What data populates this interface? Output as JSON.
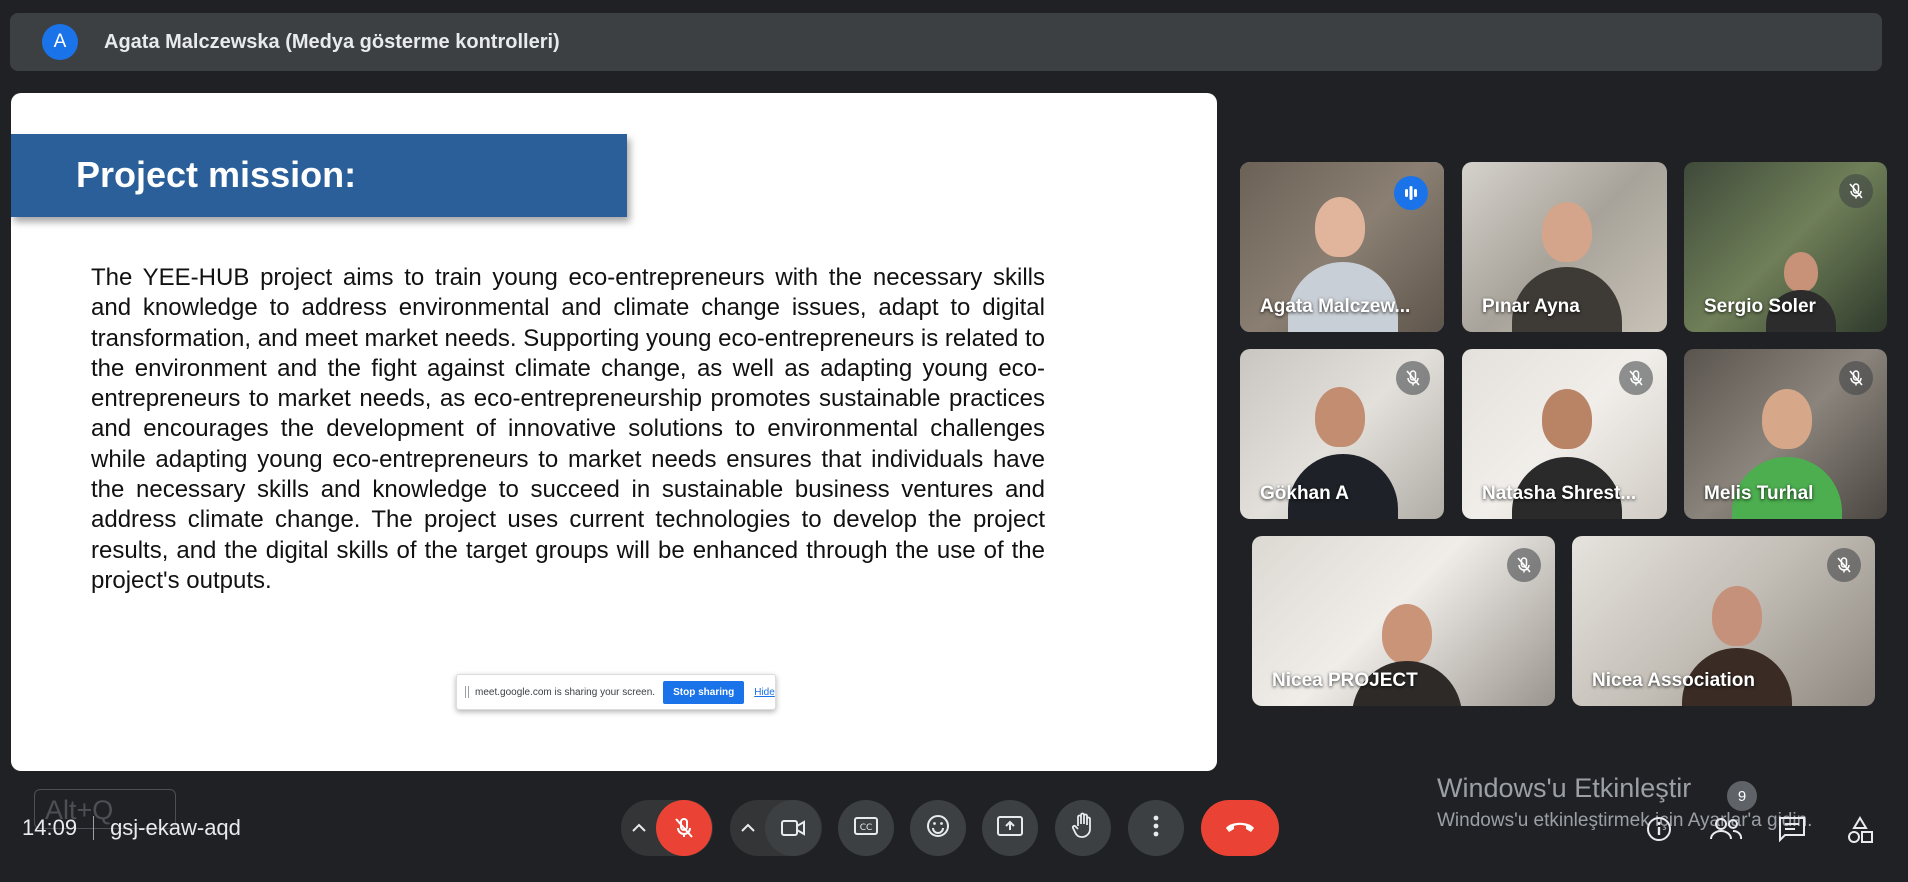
{
  "header": {
    "avatar_letter": "A",
    "title": "Agata Malczewska (Medya gösterme kontrolleri)"
  },
  "slide": {
    "heading": "Project mission:",
    "body": "The YEE-HUB project aims to train young eco-entrepreneurs with the necessary skills and knowledge to address environmental and climate change issues, adapt to digital transformation, and meet market needs. Supporting young eco-entrepreneurs is related to the environment and the fight against climate change, as well as adapting young eco-entrepreneurs to market needs, as eco-entrepreneurship promotes sustainable practices and encourages the development of innovative solutions to environmental challenges while adapting young eco-entrepreneurs to market needs ensures that individuals have the necessary skills and knowledge to succeed in sustainable business ventures and address climate change. The project uses current technologies to develop the project results, and the digital skills of the target groups will be enhanced through the use of the project's outputs.",
    "share_bar": {
      "message": "meet.google.com is sharing your screen.",
      "stop_label": "Stop sharing",
      "hide_label": "Hide"
    }
  },
  "participants": [
    {
      "name": "Agata Malczew...",
      "speaking": true
    },
    {
      "name": "Pınar Ayna",
      "muted": false
    },
    {
      "name": "Sergio Soler",
      "muted": true
    },
    {
      "name": "Gökhan A",
      "muted": true
    },
    {
      "name": "Natasha Shrest...",
      "muted": true
    },
    {
      "name": "Melis Turhal",
      "muted": true
    },
    {
      "name": "Nicea PROJECT",
      "muted": true
    },
    {
      "name": "Nicea Association",
      "muted": true
    }
  ],
  "watermark": {
    "line1": "Windows'u Etkinleştir",
    "line2": "Windows'u etkinleştirmek için Ayarlar'a gidin."
  },
  "footer": {
    "time": "14:09",
    "meeting_code": "gsj-ekaw-aqd",
    "shortcut_hint": "Alt+Q",
    "participant_count": "9"
  },
  "colors": {
    "background": "#202124",
    "end_call": "#ea4335",
    "accent": "#1a73e8",
    "slide_banner": "#2a5f9a"
  }
}
